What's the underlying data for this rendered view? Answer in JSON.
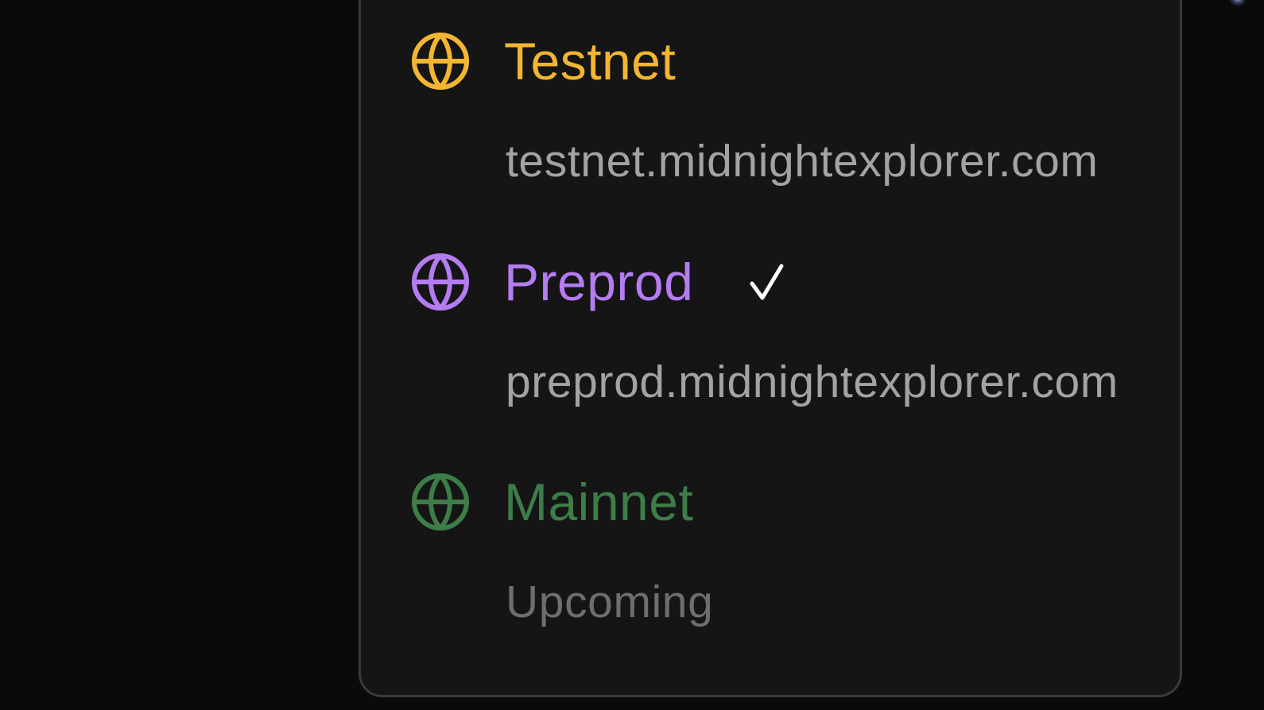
{
  "colors": {
    "testnet": "#f2b632",
    "preprod": "#b57cf2",
    "mainnet": "#3d7d48",
    "check": "#ffffff",
    "url_text": "#a3a3a6",
    "upcoming_text": "#6e6e72",
    "panel_bg": "#151516",
    "panel_border": "#3a3a3c"
  },
  "networks": [
    {
      "name": "Testnet",
      "subtitle": "testnet.midnightexplorer.com",
      "icon": "globe-icon",
      "selected": false
    },
    {
      "name": "Preprod",
      "subtitle": "preprod.midnightexplorer.com",
      "icon": "globe-icon",
      "selected": true,
      "selected_icon": "checkmark-icon"
    },
    {
      "name": "Mainnet",
      "subtitle": "Upcoming",
      "icon": "globe-icon",
      "selected": false
    }
  ]
}
